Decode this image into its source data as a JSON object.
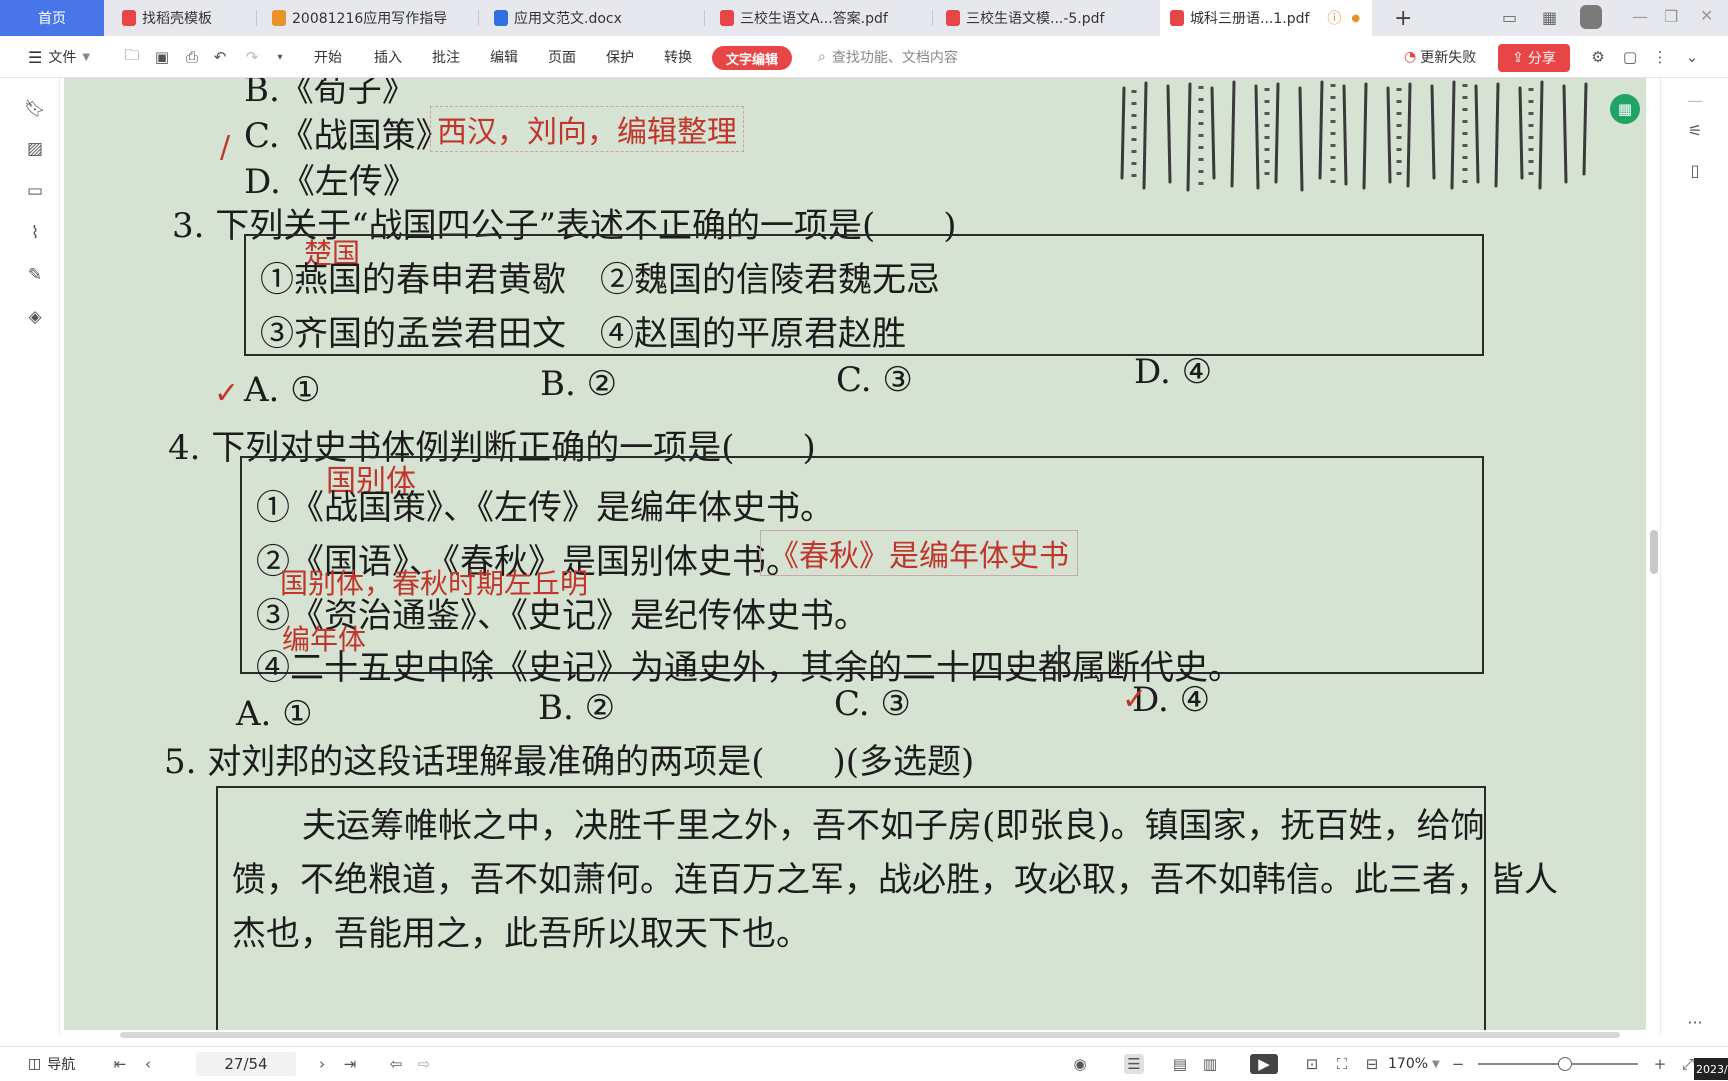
{
  "tabs": {
    "home": "首页",
    "items": [
      {
        "label": "找稻壳模板",
        "color": "#e84546"
      },
      {
        "label": "20081216应用写作指导",
        "color": "#e8922a"
      },
      {
        "label": "应用文范文.docx",
        "color": "#2f6fe0"
      },
      {
        "label": "三校生语文A...答案.pdf",
        "color": "#e84546"
      },
      {
        "label": "三校生语文模...-5.pdf",
        "color": "#e84546"
      },
      {
        "label": "城科三册语...1.pdf",
        "color": "#e84546"
      }
    ],
    "add": "+"
  },
  "toolbar": {
    "file": "文件",
    "menus": [
      "开始",
      "插入",
      "批注",
      "编辑",
      "页面",
      "保护",
      "转换"
    ],
    "text_edit": "文字编辑",
    "search_placeholder": "查找功能、文档内容",
    "update_failed": "更新失败",
    "share": "分享"
  },
  "doc": {
    "q2": {
      "optB": "B.《荀子》",
      "optC": "C.《战国策》",
      "optC_note": "西汉，刘向，编辑整理",
      "optD": "D.《左传》"
    },
    "q3": {
      "stem": "3. 下列关于“战国四公子”表述不正确的一项是(　　)",
      "note": "楚国",
      "line1": "①燕国的春申君黄歇　②魏国的信陵君魏无忌",
      "line2": "③齐国的孟尝君田文　④赵国的平原君赵胜",
      "choices": [
        "A. ①",
        "B. ②",
        "C. ③",
        "D. ④"
      ]
    },
    "q4": {
      "stem": "4. 下列对史书体例判断正确的一项是(　　)",
      "note1": "国别体",
      "line1": "①《战国策》、《左传》是编年体史书。",
      "line2": "②《国语》、《春秋》是国别体史书。",
      "line2_note": "《春秋》是编年体史书",
      "note2": "国别体，春秋时期左丘明",
      "line3": "③《资治通鉴》、《史记》是纪传体史书。",
      "note3": "编年体",
      "line4": "④二十五史中除《史记》为通史外，其余的二十四史都属断代史。",
      "choices": [
        "A. ①",
        "B. ②",
        "C. ③",
        "D. ④"
      ]
    },
    "q5": {
      "stem": "5. 对刘邦的这段话理解最准确的两项是(　　)(多选题)",
      "p1": "夫运筹帷帐之中，决胜千里之外，吾不如子房(即张良)。镇国家，抚百姓，给饷",
      "p2": "馈，不绝粮道，吾不如萧何。连百万之军，战必胜，攻必取，吾不如韩信。此三者，皆人",
      "p3": "杰也，吾能用之，此吾所以取天下也。"
    }
  },
  "status": {
    "nav": "导航",
    "page": "27/54",
    "zoom": "170%",
    "zoom_level_percent": 50,
    "date": "2023/"
  }
}
